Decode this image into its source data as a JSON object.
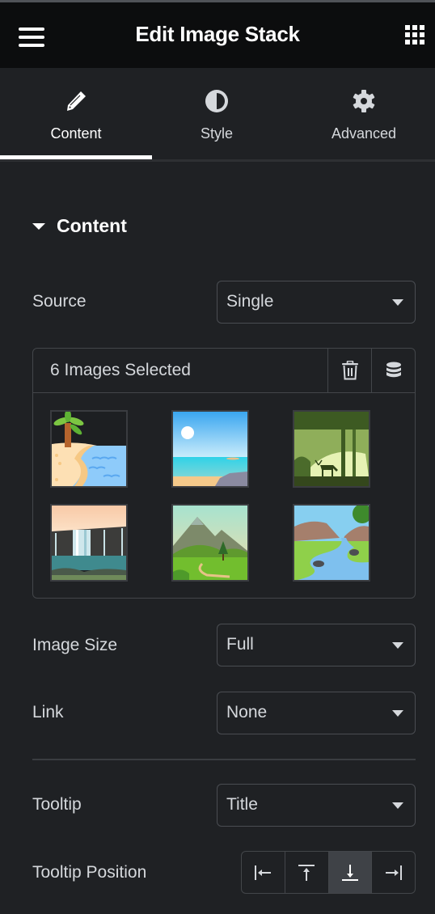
{
  "header": {
    "title": "Edit Image Stack",
    "menu_icon": "hamburger-icon",
    "apps_icon": "grid-icon"
  },
  "tabs": [
    {
      "label": "Content",
      "icon": "pencil-icon",
      "active": true
    },
    {
      "label": "Style",
      "icon": "half-circle-icon",
      "active": false
    },
    {
      "label": "Advanced",
      "icon": "gear-icon",
      "active": false
    }
  ],
  "section": {
    "title": "Content",
    "expanded": true
  },
  "fields": {
    "source": {
      "label": "Source",
      "value": "Single"
    },
    "gallery": {
      "count_text": "6 Images Selected",
      "delete_icon": "trash-icon",
      "library_icon": "database-icon",
      "images": [
        {
          "name": "beach-palm"
        },
        {
          "name": "sunny-ocean"
        },
        {
          "name": "forest-deer"
        },
        {
          "name": "waterfall"
        },
        {
          "name": "mountain-valley"
        },
        {
          "name": "river-canyon"
        }
      ]
    },
    "image_size": {
      "label": "Image Size",
      "value": "Full"
    },
    "link": {
      "label": "Link",
      "value": "None"
    },
    "tooltip": {
      "label": "Tooltip",
      "value": "Title"
    },
    "tooltip_position": {
      "label": "Tooltip Position",
      "options": [
        {
          "name": "left",
          "icon": "align-left-arrow-icon",
          "active": false
        },
        {
          "name": "top",
          "icon": "align-top-arrow-icon",
          "active": false
        },
        {
          "name": "bottom",
          "icon": "align-bottom-arrow-icon",
          "active": true
        },
        {
          "name": "right",
          "icon": "align-right-arrow-icon",
          "active": false
        }
      ]
    }
  },
  "colors": {
    "panel_bg": "#1f2124",
    "header_bg": "#0c0d0e",
    "text": "#d5d8dc",
    "border": "#43464a",
    "active_option_bg": "#3f4247"
  }
}
